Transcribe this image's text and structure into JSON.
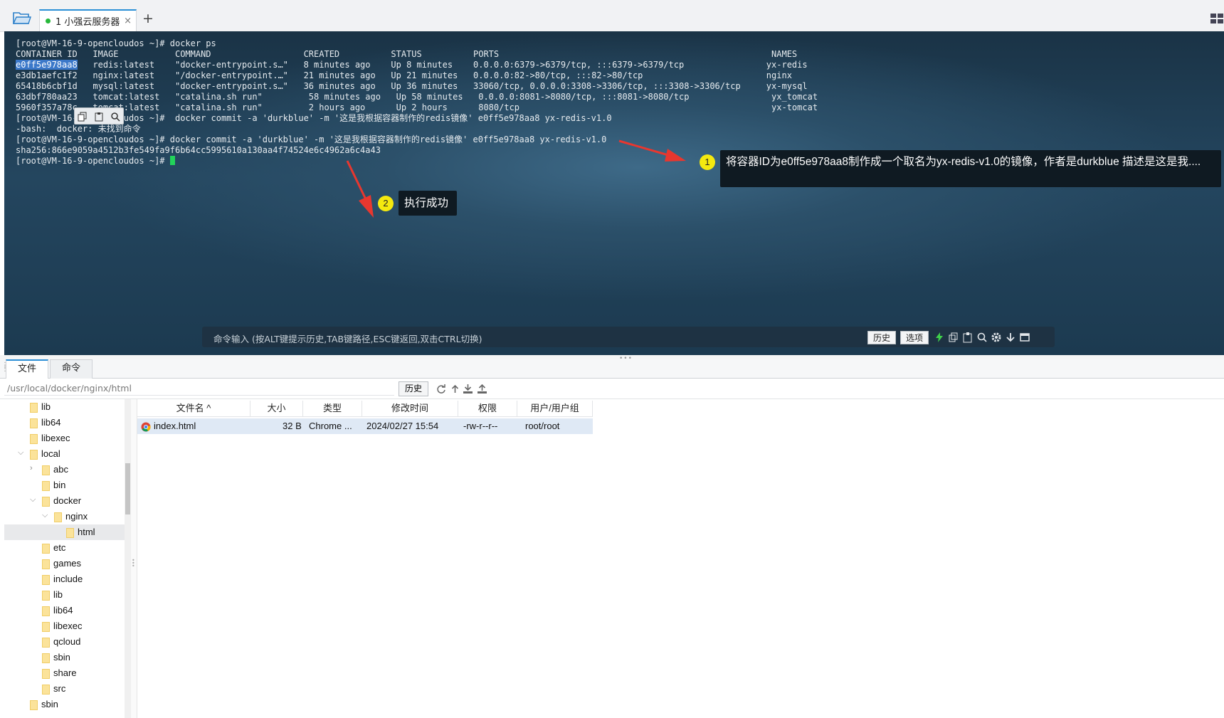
{
  "tabbar": {
    "session_tab": {
      "label": "1 小强云服务器",
      "close": "×"
    },
    "add_tab": "+"
  },
  "terminal": {
    "lines": [
      "[root@VM-16-9-opencloudos ~]# docker ps",
      "CONTAINER ID   IMAGE           COMMAND                  CREATED          STATUS          PORTS                                                     NAMES",
      "e0ff5e978aa8   redis:latest    \"docker-entrypoint.s…\"   8 minutes ago    Up 8 minutes    0.0.0.0:6379->6379/tcp, :::6379->6379/tcp                yx-redis",
      "e3db1aefc1f2   nginx:latest    \"/docker-entrypoint.…\"   21 minutes ago   Up 21 minutes   0.0.0.0:82->80/tcp, :::82->80/tcp                        nginx",
      "65418b6cbf1d   mysql:latest    \"docker-entrypoint.s…\"   36 minutes ago   Up 36 minutes   33060/tcp, 0.0.0.0:3308->3306/tcp, :::3308->3306/tcp     yx-mysql",
      "63dbf780aa23   tomcat:latest   \"catalina.sh run\"         58 minutes ago   Up 58 minutes   0.0.0.0:8081->8080/tcp, :::8081->8080/tcp                yx_tomcat",
      "5960f357a78c   tomcat:latest   \"catalina.sh run\"         2 hours ago      Up 2 hours      8080/tcp                                                 yx-tomcat",
      "[root@VM-16-9-opencloudos ~]#  docker commit -a 'durkblue' -m '这是我根据容器制作的redis镜像' e0ff5e978aa8 yx-redis-v1.0",
      "-bash:  docker: 未找到命令",
      "[root@VM-16-9-opencloudos ~]# docker commit -a 'durkblue' -m '这是我根据容器制作的redis镜像' e0ff5e978aa8 yx-redis-v1.0",
      "sha256:866e9059a4512b3fe549fa9f6b64cc5995610a130aa4f74524e6c4962a6c4a43",
      "[root@VM-16-9-opencloudos ~]# "
    ],
    "selected_text": "e0ff5e978aa8",
    "annotations": [
      {
        "number": "1",
        "text": "将容器ID为e0ff5e978aa8制作成一个取名为yx-redis-v1.0的镜像，作者是durkblue  描述是这是我...."
      },
      {
        "number": "2",
        "text": "执行成功"
      }
    ],
    "command_bar": {
      "placeholder": "命令输入 (按ALT键提示历史,TAB键路径,ESC键返回,双击CTRL切换)",
      "history_button": "历史",
      "options_button": "选项"
    }
  },
  "bottom": {
    "tabs": [
      "文件",
      "命令"
    ],
    "active_tab": "文件",
    "path": "/usr/local/docker/nginx/html",
    "history_button": "历史",
    "tree": [
      {
        "label": "lib",
        "depth": 1,
        "toggle": ""
      },
      {
        "label": "lib64",
        "depth": 1,
        "toggle": ""
      },
      {
        "label": "libexec",
        "depth": 1,
        "toggle": ""
      },
      {
        "label": "local",
        "depth": 1,
        "toggle": "⌵"
      },
      {
        "label": "abc",
        "depth": 2,
        "toggle": "›"
      },
      {
        "label": "bin",
        "depth": 2,
        "toggle": ""
      },
      {
        "label": "docker",
        "depth": 2,
        "toggle": "⌵"
      },
      {
        "label": "nginx",
        "depth": 3,
        "toggle": "⌵"
      },
      {
        "label": "html",
        "depth": 4,
        "toggle": "",
        "selected": true
      },
      {
        "label": "etc",
        "depth": 2,
        "toggle": ""
      },
      {
        "label": "games",
        "depth": 2,
        "toggle": ""
      },
      {
        "label": "include",
        "depth": 2,
        "toggle": ""
      },
      {
        "label": "lib",
        "depth": 2,
        "toggle": ""
      },
      {
        "label": "lib64",
        "depth": 2,
        "toggle": ""
      },
      {
        "label": "libexec",
        "depth": 2,
        "toggle": ""
      },
      {
        "label": "qcloud",
        "depth": 2,
        "toggle": ""
      },
      {
        "label": "sbin",
        "depth": 2,
        "toggle": ""
      },
      {
        "label": "share",
        "depth": 2,
        "toggle": ""
      },
      {
        "label": "src",
        "depth": 2,
        "toggle": ""
      },
      {
        "label": "sbin",
        "depth": 1,
        "toggle": ""
      }
    ],
    "file_table": {
      "columns": [
        "文件名 ^",
        "大小",
        "类型",
        "修改时间",
        "权限",
        "用户/用户组"
      ],
      "rows": [
        {
          "name": "index.html",
          "size": "32 B",
          "type": "Chrome ...",
          "modified": "2024/02/27 15:54",
          "perms": "-rw-r--r--",
          "owner": "root/root"
        }
      ]
    }
  }
}
